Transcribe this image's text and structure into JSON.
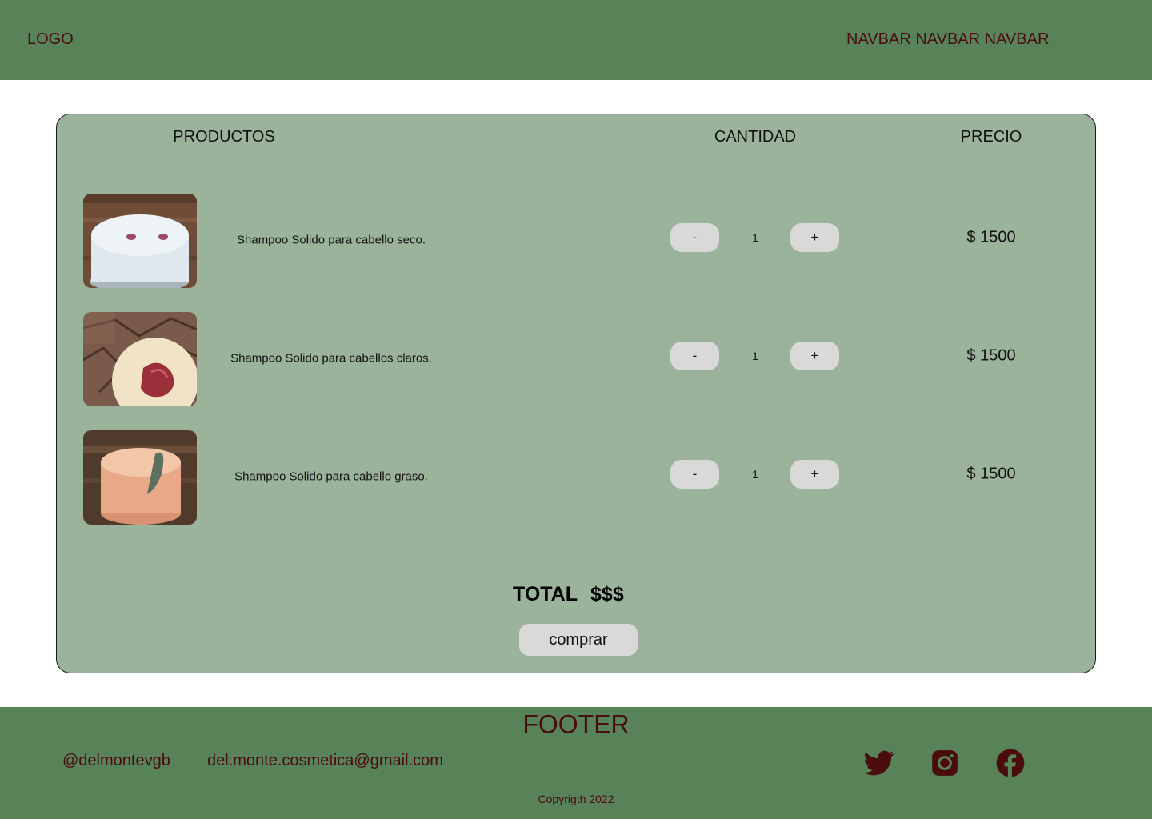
{
  "header": {
    "logo": "LOGO",
    "navbar": "NAVBAR NAVBAR NAVBAR"
  },
  "cart": {
    "columns": {
      "products": "PRODUCTOS",
      "quantity": "CANTIDAD",
      "price": "PRECIO"
    },
    "items": [
      {
        "name": "Shampoo Solido para cabello seco.",
        "minus": "-",
        "qty": "1",
        "plus": "+",
        "price": "$ 1500"
      },
      {
        "name": "Shampoo Solido para  cabellos claros.",
        "minus": "-",
        "qty": "1",
        "plus": "+",
        "price": "$ 1500"
      },
      {
        "name": "Shampoo Solido para cabello graso.",
        "minus": "-",
        "qty": "1",
        "plus": "+",
        "price": "$ 1500"
      }
    ],
    "total_label": "TOTAL",
    "total_value": "$$$",
    "buy_label": "comprar"
  },
  "footer": {
    "title": "FOOTER",
    "handle": "@delmontevgb",
    "email": "del.monte.cosmetica@gmail.com",
    "copyright": "Copyrigth 2022",
    "social_icons": [
      "twitter-icon",
      "instagram-icon",
      "facebook-icon"
    ]
  },
  "colors": {
    "header_footer_bg": "#588359",
    "cart_bg": "#9bb39b",
    "text_accent": "#4a0c0c",
    "button_bg": "#d9d9d9"
  }
}
